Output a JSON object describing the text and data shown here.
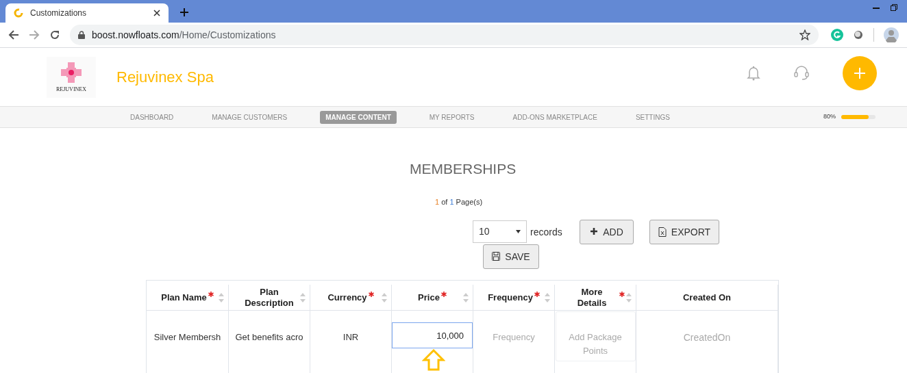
{
  "browser": {
    "tab_title": "Customizations",
    "url_host": "boost.nowfloats.com",
    "url_path": "/Home/Customizations"
  },
  "header": {
    "logo_text": "REJUVINEX",
    "brand": "Rejuvinex Spa"
  },
  "nav": {
    "items": [
      {
        "label": "DASHBOARD",
        "selected": false
      },
      {
        "label": "MANAGE CUSTOMERS",
        "selected": false
      },
      {
        "label": "MANAGE CONTENT",
        "selected": true
      },
      {
        "label": "MY REPORTS",
        "selected": false
      },
      {
        "label": "ADD-ONS MARKETPLACE",
        "selected": false
      },
      {
        "label": "SETTINGS",
        "selected": false
      }
    ],
    "progress": {
      "reading": "80%",
      "level": 0.8
    }
  },
  "page": {
    "title": "MEMBERSHIPS",
    "pager": {
      "current": "1",
      "of": "of",
      "total": "1",
      "suffix": "Page(s)"
    },
    "records_select": {
      "value": "10",
      "label": "records"
    },
    "buttons": [
      {
        "kind": "add",
        "label": "ADD"
      },
      {
        "kind": "export",
        "label": "EXPORT"
      },
      {
        "kind": "save",
        "label": "SAVE"
      }
    ]
  },
  "table": {
    "columns": [
      {
        "label": "Plan Name",
        "required": true,
        "sortable": true
      },
      {
        "label": "Plan Description",
        "required": false,
        "sortable": true
      },
      {
        "label": "Currency",
        "required": true,
        "sortable": true
      },
      {
        "label": "Price",
        "required": true,
        "sortable": true
      },
      {
        "label": "Frequency",
        "required": true,
        "sortable": true
      },
      {
        "label": "More Details",
        "required": true,
        "sortable": true
      },
      {
        "label": "Created On",
        "required": false,
        "sortable": false
      }
    ],
    "rows": [
      {
        "cells": [
          {
            "kind": "text",
            "text": "Silver Membersh"
          },
          {
            "kind": "text",
            "text": "Get benefits acro"
          },
          {
            "kind": "text",
            "text": "INR"
          },
          {
            "kind": "input",
            "value": "10,000"
          },
          {
            "kind": "placeholder",
            "text": "Frequency"
          },
          {
            "kind": "box",
            "placeholder": "Add Package Points"
          },
          {
            "kind": "placeholder",
            "text": "CreatedOn"
          }
        ]
      }
    ]
  }
}
